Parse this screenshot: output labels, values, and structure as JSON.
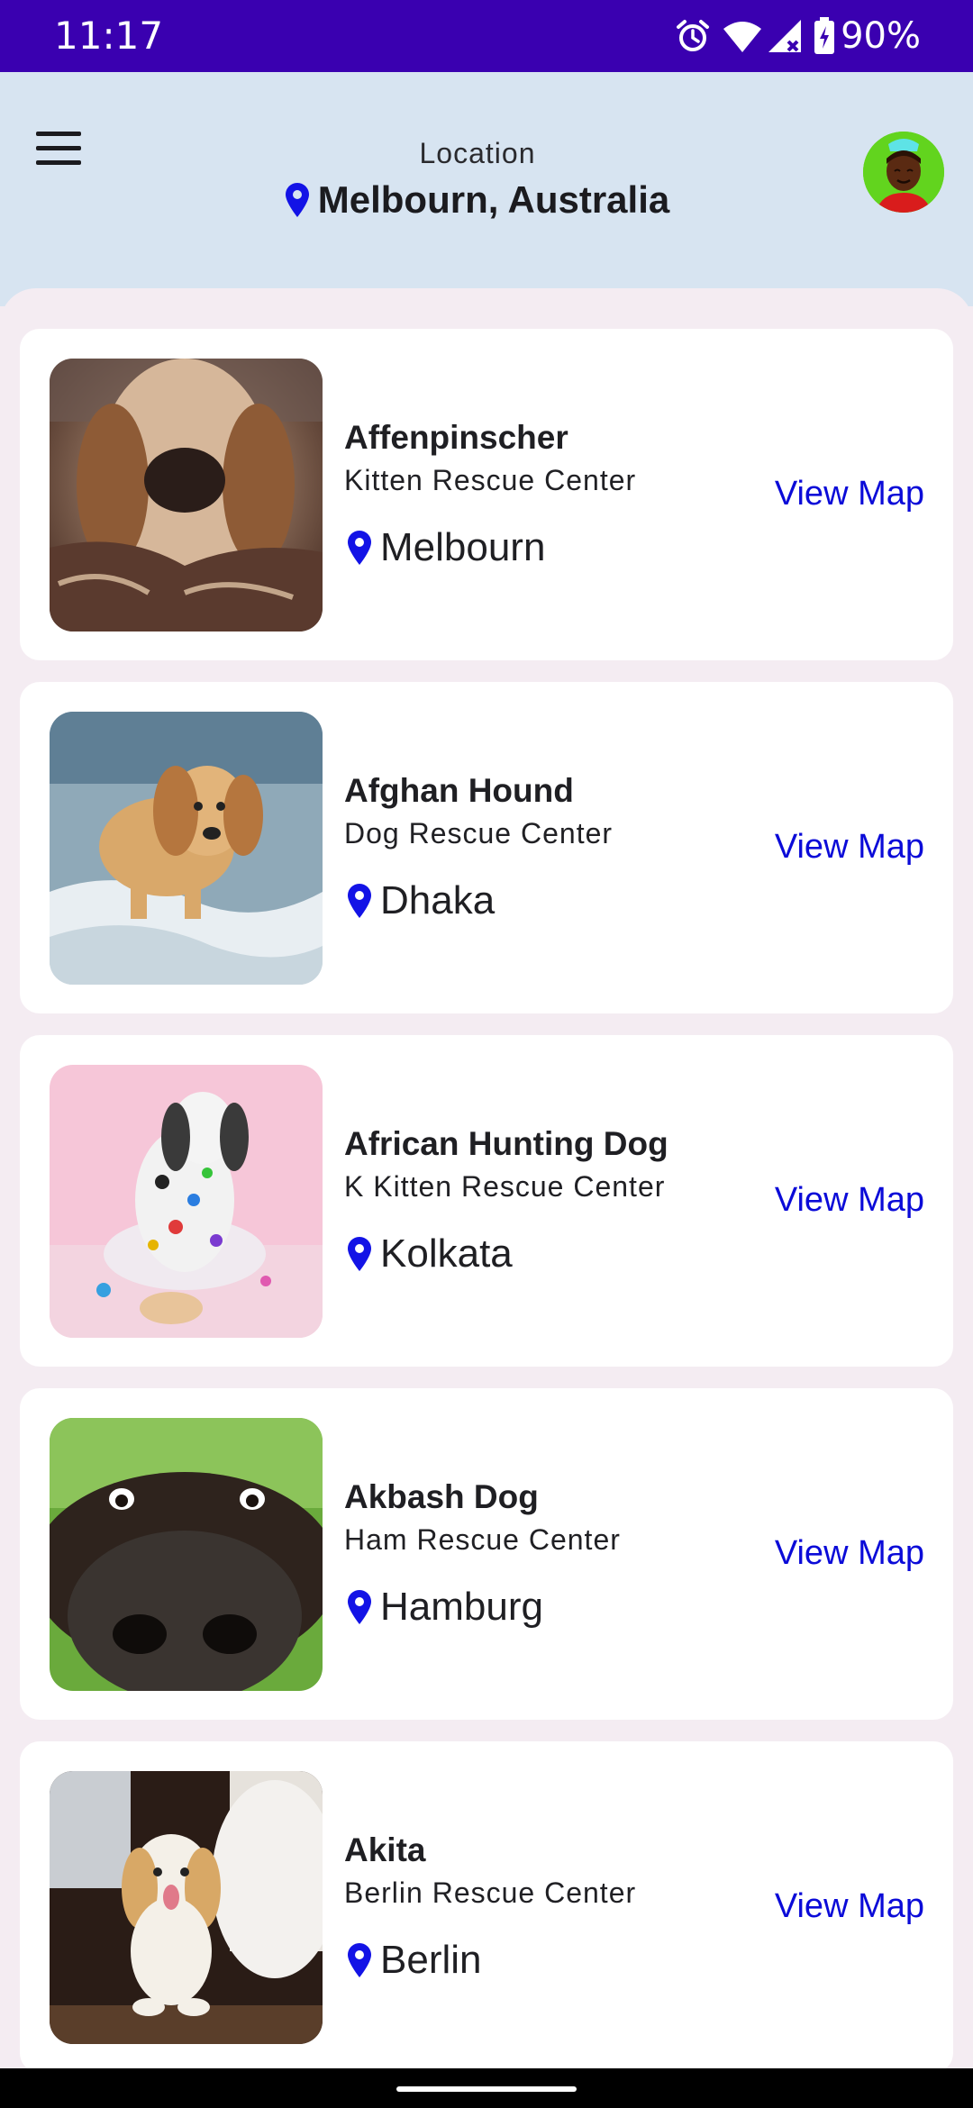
{
  "status_bar": {
    "time": "11:17",
    "battery": "90%",
    "icons": [
      "alarm-icon",
      "wifi-icon",
      "signal-icon",
      "battery-charging-icon"
    ]
  },
  "header": {
    "menu_icon": "hamburger-menu-icon",
    "location_label": "Location",
    "location_value": "Melbourn, Australia",
    "pin_color": "#1313e6",
    "avatar_bg": "#62d41e"
  },
  "theme": {
    "status_bar_bg": "#3a00b0",
    "header_bg": "#d7e4f1",
    "sheet_bg": "#f4ecf2",
    "card_bg": "#ffffff",
    "link_color": "#0b0bd8"
  },
  "pets": [
    {
      "name": "Affenpinscher",
      "center": "Kitten Rescue Center",
      "city": "Melbourn",
      "action": "View Map",
      "image": "dog-on-blanket-photo"
    },
    {
      "name": "Afghan Hound",
      "center": "Dog Rescue Center",
      "city": "Dhaka",
      "action": "View Map",
      "image": "puppy-in-water-photo"
    },
    {
      "name": "African Hunting Dog",
      "center": "K Kitten Rescue Center",
      "city": "Kolkata",
      "action": "View Map",
      "image": "paint-splattered-dog-photo"
    },
    {
      "name": "Akbash Dog",
      "center": "Ham Rescue Center",
      "city": "Hamburg",
      "action": "View Map",
      "image": "dog-nose-closeup-photo"
    },
    {
      "name": "Akita",
      "center": "Berlin Rescue Center",
      "city": "Berlin",
      "action": "View Map",
      "image": "white-puppy-photo"
    }
  ]
}
